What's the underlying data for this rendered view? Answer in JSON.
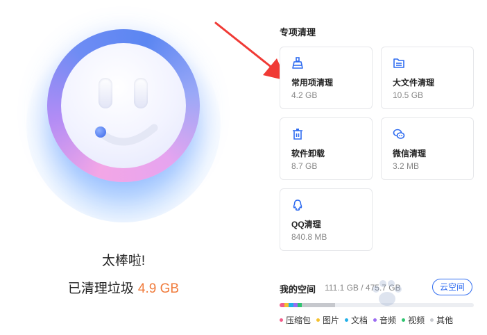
{
  "status": {
    "title": "太棒啦!",
    "cleaned_prefix": "已清理垃圾",
    "cleaned_amount": "4.9 GB"
  },
  "section": {
    "title": "专项清理"
  },
  "cards": [
    {
      "name": "常用项清理",
      "size": "4.2 GB",
      "icon": "broom-icon"
    },
    {
      "name": "大文件清理",
      "size": "10.5 GB",
      "icon": "folder-icon"
    },
    {
      "name": "软件卸载",
      "size": "8.7 GB",
      "icon": "trash-icon"
    },
    {
      "name": "微信清理",
      "size": "3.2 MB",
      "icon": "wechat-icon"
    },
    {
      "name": "QQ清理",
      "size": "840.8 MB",
      "icon": "qq-icon"
    }
  ],
  "space": {
    "title": "我的空间",
    "usage": "111.1 GB / 475.7 GB",
    "cloud_button": "云空间",
    "legend": [
      {
        "label": "压缩包",
        "color": "#f25c8a"
      },
      {
        "label": "图片",
        "color": "#f5c12e"
      },
      {
        "label": "文档",
        "color": "#23b0e8"
      },
      {
        "label": "音频",
        "color": "#9b6cf2"
      },
      {
        "label": "视频",
        "color": "#2fc46f"
      },
      {
        "label": "其他",
        "color": "#c6c8cd"
      }
    ]
  },
  "colors": {
    "accent": "#2f6cf0",
    "amount": "#f07a3a",
    "arrow": "#f03a35"
  }
}
